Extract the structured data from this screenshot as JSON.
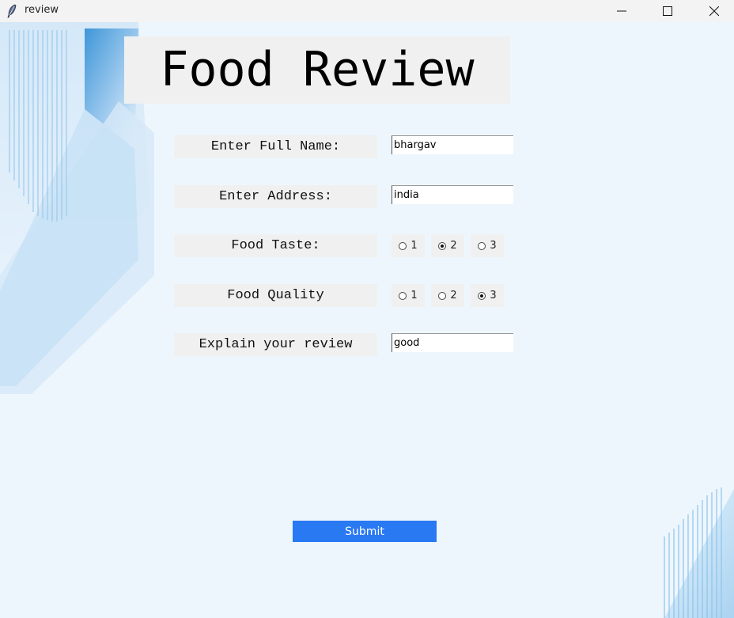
{
  "window": {
    "title": "review",
    "controls": {
      "minimize": "minimize-icon",
      "maximize": "maximize-icon",
      "close": "close-icon"
    }
  },
  "form": {
    "heading": "Food Review",
    "full_name": {
      "label": "Enter Full Name:",
      "value": "bhargav"
    },
    "address": {
      "label": "Enter Address:",
      "value": "india"
    },
    "taste": {
      "label": "Food Taste:",
      "options": [
        "1",
        "2",
        "3"
      ],
      "selected": "2"
    },
    "quality": {
      "label": "Food Quality",
      "options": [
        "1",
        "2",
        "3"
      ],
      "selected": "3"
    },
    "review": {
      "label": "Explain your review",
      "value": "good"
    },
    "submit_label": "Submit"
  },
  "colors": {
    "background": "#eef6fd",
    "label_bg": "#f0f0f0",
    "accent": "#2979f2",
    "decor_blue": "#3d95d6"
  }
}
